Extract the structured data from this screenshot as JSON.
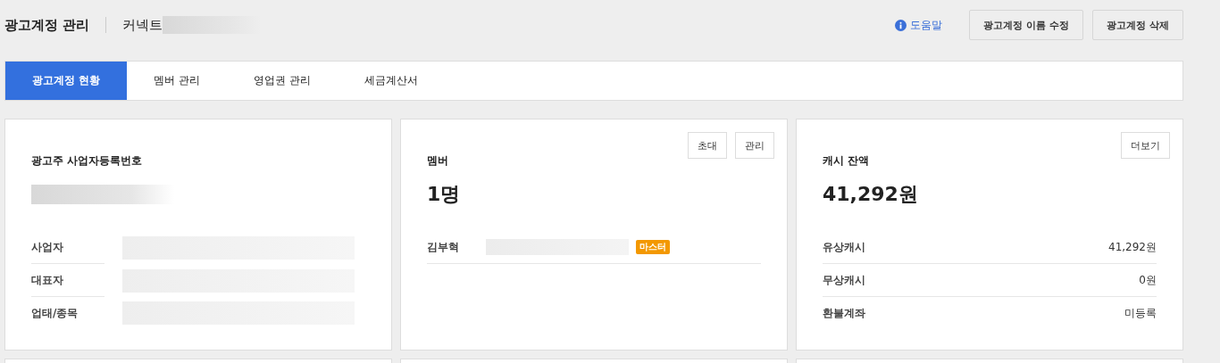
{
  "header": {
    "title": "광고계정 관리",
    "account_name": "커넥트",
    "account_name_redacted": true,
    "help_link": "도움말",
    "buttons": [
      "광고계정 이름 수정",
      "광고계정 삭제"
    ]
  },
  "tabs": [
    {
      "label": "광고계정 현황",
      "selected": true
    },
    {
      "label": "멤버 관리",
      "selected": false
    },
    {
      "label": "영업권 관리",
      "selected": false
    },
    {
      "label": "세금계산서",
      "selected": false
    }
  ],
  "cards": [
    {
      "kind": "business",
      "title": "광고주 사업자등록번호",
      "value_redacted": true,
      "rows": [
        {
          "label": "사업자",
          "value_redacted": true
        },
        {
          "label": "대표자",
          "value_redacted": true
        },
        {
          "label": "업태/종목",
          "value_redacted": true
        }
      ]
    },
    {
      "kind": "members",
      "title": "멤버",
      "value": "1명",
      "buttons": [
        "초대",
        "관리"
      ],
      "members": [
        {
          "name": "김부혁",
          "detail_redacted": true,
          "badge": "마스터"
        }
      ]
    },
    {
      "kind": "cash",
      "title": "캐시 잔액",
      "value": "41,292원",
      "buttons": [
        "더보기"
      ],
      "rows": [
        {
          "label": "유상캐시",
          "value": "41,292원"
        },
        {
          "label": "무상캐시",
          "value": "0원"
        },
        {
          "label": "환불계좌",
          "value": "미등록"
        }
      ]
    }
  ]
}
